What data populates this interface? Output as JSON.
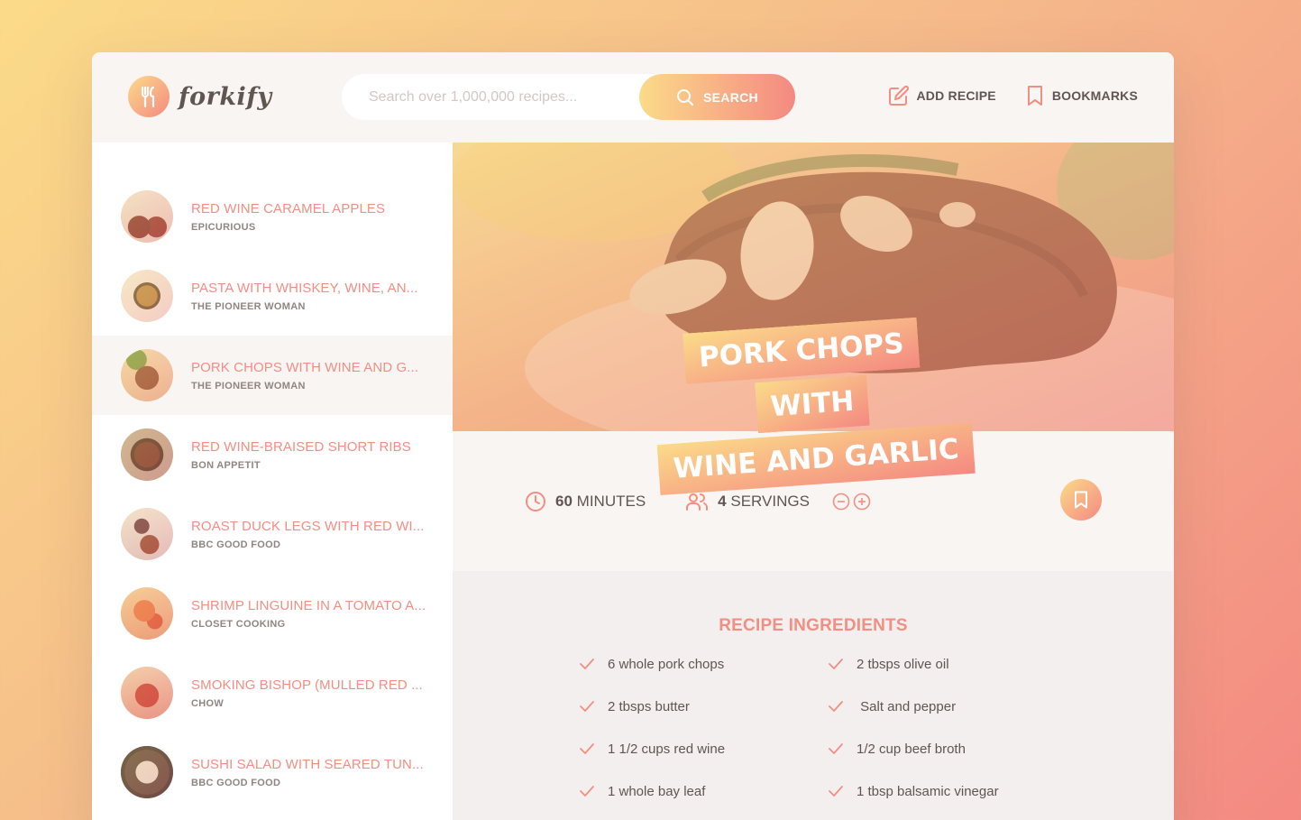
{
  "brand": {
    "name": "forkify"
  },
  "search": {
    "placeholder": "Search over 1,000,000 recipes...",
    "button_label": "SEARCH"
  },
  "nav": {
    "add_recipe": "ADD RECIPE",
    "bookmarks": "BOOKMARKS"
  },
  "results": [
    {
      "title": "RED WINE CARAMEL APPLES",
      "publisher": "EPICURIOUS",
      "thumb": "apples-icon"
    },
    {
      "title": "PASTA WITH WHISKEY, WINE, AN...",
      "publisher": "THE PIONEER WOMAN",
      "thumb": "pasta-icon"
    },
    {
      "title": "PORK CHOPS WITH WINE AND G...",
      "publisher": "THE PIONEER WOMAN",
      "thumb": "pork-chops-icon"
    },
    {
      "title": "RED WINE-BRAISED SHORT RIBS",
      "publisher": "BON APPETIT",
      "thumb": "short-ribs-icon"
    },
    {
      "title": "ROAST DUCK LEGS WITH RED WI...",
      "publisher": "BBC GOOD FOOD",
      "thumb": "duck-legs-icon"
    },
    {
      "title": "SHRIMP LINGUINE IN A TOMATO A...",
      "publisher": "CLOSET COOKING",
      "thumb": "shrimp-linguine-icon"
    },
    {
      "title": "SMOKING BISHOP (MULLED RED ...",
      "publisher": "CHOW",
      "thumb": "mulled-wine-icon"
    },
    {
      "title": "SUSHI SALAD WITH SEARED TUN...",
      "publisher": "BBC GOOD FOOD",
      "thumb": "sushi-salad-icon"
    }
  ],
  "recipe": {
    "title_line1": "PORK CHOPS WITH",
    "title_line2": "WINE AND GARLIC",
    "minutes": "60",
    "minutes_label": "MINUTES",
    "servings": "4",
    "servings_label": "SERVINGS",
    "ingredients_heading": "RECIPE INGREDIENTS",
    "ingredients": [
      "6 whole pork chops",
      "2 tbsps olive oil",
      "2 tbsps butter",
      " Salt and pepper",
      "1 1/2 cups red wine",
      "1/2 cup beef broth",
      "1 whole bay leaf",
      "1 tbsp balsamic vinegar"
    ]
  },
  "colors": {
    "accent": "#f38e82",
    "gradient_start": "#fbdb89",
    "gradient_end": "#f48982",
    "text": "#615551",
    "panel": "#f9f5f3"
  }
}
